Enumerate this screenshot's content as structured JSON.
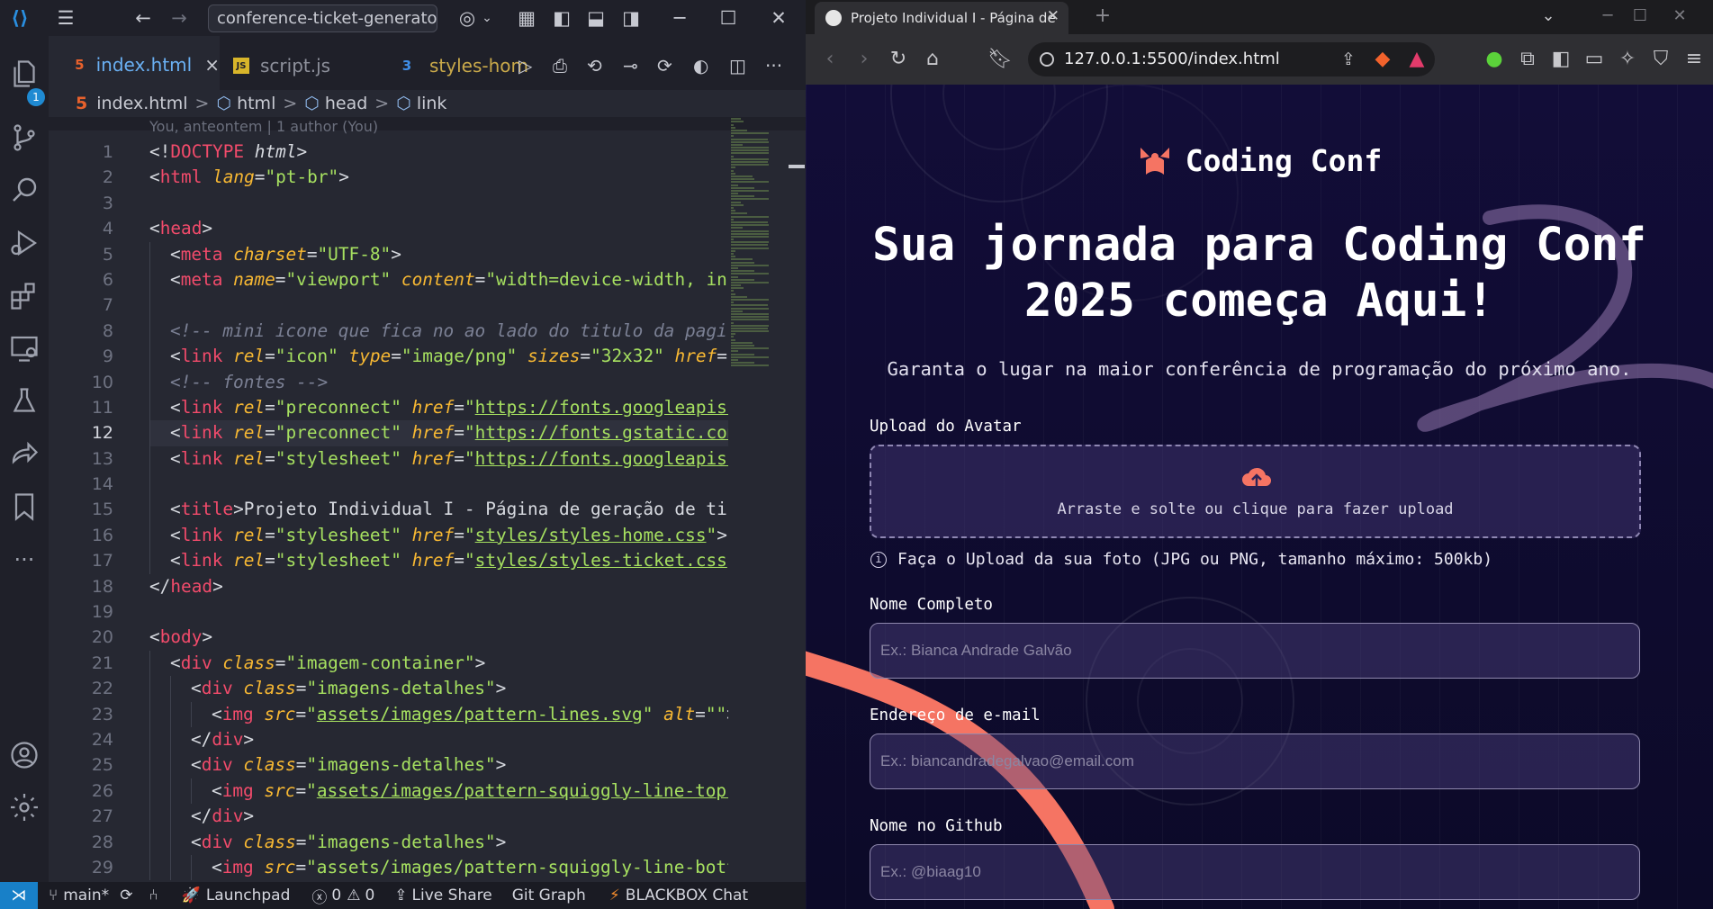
{
  "vscode": {
    "search_text": "conference-ticket-generator-m",
    "tabs": [
      {
        "label": "index.html",
        "icon": "5",
        "close": "×"
      },
      {
        "label": "script.js",
        "icon": "JS"
      },
      {
        "label": "styles-hom",
        "icon": "3"
      }
    ],
    "breadcrumb": [
      "index.html",
      "html",
      "head",
      "link"
    ],
    "breadcrumb_sep": ">",
    "blame": "You, anteontem | 1 author (You)",
    "explorer_badge": "1",
    "current_line": 12,
    "lines": [
      [
        [
          "t-punc",
          "<!"
        ],
        [
          "t-doc",
          "DOCTYPE"
        ],
        [
          "t-punc",
          " "
        ],
        [
          "t-kw",
          "html"
        ],
        [
          "t-punc",
          ">"
        ]
      ],
      [
        [
          "t-punc",
          "<"
        ],
        [
          "t-tag",
          "html"
        ],
        [
          "t-punc",
          " "
        ],
        [
          "t-attr",
          "lang"
        ],
        [
          "t-punc",
          "="
        ],
        [
          "t-str",
          "\"pt-br\""
        ],
        [
          "t-punc",
          ">"
        ]
      ],
      [],
      [
        [
          "t-punc",
          "<"
        ],
        [
          "t-tag",
          "head"
        ],
        [
          "t-punc",
          ">"
        ]
      ],
      [
        [
          "i",
          ""
        ],
        [
          "t-punc",
          "<"
        ],
        [
          "t-tag",
          "meta"
        ],
        [
          "t-punc",
          " "
        ],
        [
          "t-attr",
          "charset"
        ],
        [
          "t-punc",
          "="
        ],
        [
          "t-str",
          "\"UTF-8\""
        ],
        [
          "t-punc",
          ">"
        ]
      ],
      [
        [
          "i",
          ""
        ],
        [
          "t-punc",
          "<"
        ],
        [
          "t-tag",
          "meta"
        ],
        [
          "t-punc",
          " "
        ],
        [
          "t-attr",
          "name"
        ],
        [
          "t-punc",
          "="
        ],
        [
          "t-str",
          "\"viewport\""
        ],
        [
          "t-punc",
          " "
        ],
        [
          "t-attr",
          "content"
        ],
        [
          "t-punc",
          "="
        ],
        [
          "t-str",
          "\"width=device-width, ini"
        ]
      ],
      [
        [
          "i",
          ""
        ]
      ],
      [
        [
          "i",
          ""
        ],
        [
          "t-cmt",
          "<!-- mini icone que fica no ao lado do titulo da pagi"
        ]
      ],
      [
        [
          "i",
          ""
        ],
        [
          "t-punc",
          "<"
        ],
        [
          "t-tag",
          "link"
        ],
        [
          "t-punc",
          " "
        ],
        [
          "t-attr",
          "rel"
        ],
        [
          "t-punc",
          "="
        ],
        [
          "t-str",
          "\"icon\""
        ],
        [
          "t-punc",
          " "
        ],
        [
          "t-attr",
          "type"
        ],
        [
          "t-punc",
          "="
        ],
        [
          "t-str",
          "\"image/png\""
        ],
        [
          "t-punc",
          " "
        ],
        [
          "t-attr",
          "sizes"
        ],
        [
          "t-punc",
          "="
        ],
        [
          "t-str",
          "\"32x32\""
        ],
        [
          "t-punc",
          " "
        ],
        [
          "t-attr",
          "href"
        ],
        [
          "t-punc",
          "="
        ],
        [
          "t-str",
          "\""
        ]
      ],
      [
        [
          "i",
          ""
        ],
        [
          "t-cmt",
          "<!-- fontes -->"
        ]
      ],
      [
        [
          "i",
          ""
        ],
        [
          "t-punc",
          "<"
        ],
        [
          "t-tag",
          "link"
        ],
        [
          "t-punc",
          " "
        ],
        [
          "t-attr",
          "rel"
        ],
        [
          "t-punc",
          "="
        ],
        [
          "t-str",
          "\"preconnect\""
        ],
        [
          "t-punc",
          " "
        ],
        [
          "t-attr",
          "href"
        ],
        [
          "t-punc",
          "="
        ],
        [
          "t-str",
          "\""
        ],
        [
          "t-link",
          "https://fonts.googleapis."
        ]
      ],
      [
        [
          "i",
          ""
        ],
        [
          "t-punc",
          "<"
        ],
        [
          "t-tag",
          "link"
        ],
        [
          "t-punc",
          " "
        ],
        [
          "t-attr",
          "rel"
        ],
        [
          "t-punc",
          "="
        ],
        [
          "t-str",
          "\"preconnect\""
        ],
        [
          "t-punc",
          " "
        ],
        [
          "t-attr",
          "href"
        ],
        [
          "t-punc",
          "="
        ],
        [
          "t-str",
          "\""
        ],
        [
          "t-link",
          "https://fonts.gstatic.com"
        ]
      ],
      [
        [
          "i",
          ""
        ],
        [
          "t-punc",
          "<"
        ],
        [
          "t-tag",
          "link"
        ],
        [
          "t-punc",
          " "
        ],
        [
          "t-attr",
          "rel"
        ],
        [
          "t-punc",
          "="
        ],
        [
          "t-str",
          "\"stylesheet\""
        ],
        [
          "t-punc",
          " "
        ],
        [
          "t-attr",
          "href"
        ],
        [
          "t-punc",
          "="
        ],
        [
          "t-str",
          "\""
        ],
        [
          "t-link",
          "https://fonts.googleapis."
        ]
      ],
      [
        [
          "i",
          ""
        ]
      ],
      [
        [
          "i",
          ""
        ],
        [
          "t-punc",
          "<"
        ],
        [
          "t-tag",
          "title"
        ],
        [
          "t-punc",
          ">"
        ],
        [
          "t-punc",
          "Projeto Individual I - Página de geração de tic"
        ]
      ],
      [
        [
          "i",
          ""
        ],
        [
          "t-punc",
          "<"
        ],
        [
          "t-tag",
          "link"
        ],
        [
          "t-punc",
          " "
        ],
        [
          "t-attr",
          "rel"
        ],
        [
          "t-punc",
          "="
        ],
        [
          "t-str",
          "\"stylesheet\""
        ],
        [
          "t-punc",
          " "
        ],
        [
          "t-attr",
          "href"
        ],
        [
          "t-punc",
          "="
        ],
        [
          "t-str",
          "\""
        ],
        [
          "t-link",
          "styles/styles-home.css"
        ],
        [
          "t-str",
          "\""
        ],
        [
          "t-punc",
          ">"
        ]
      ],
      [
        [
          "i",
          ""
        ],
        [
          "t-punc",
          "<"
        ],
        [
          "t-tag",
          "link"
        ],
        [
          "t-punc",
          " "
        ],
        [
          "t-attr",
          "rel"
        ],
        [
          "t-punc",
          "="
        ],
        [
          "t-str",
          "\"stylesheet\""
        ],
        [
          "t-punc",
          " "
        ],
        [
          "t-attr",
          "href"
        ],
        [
          "t-punc",
          "="
        ],
        [
          "t-str",
          "\""
        ],
        [
          "t-link",
          "styles/styles-ticket.css"
        ],
        [
          "t-str",
          "\""
        ]
      ],
      [
        [
          "t-punc",
          "</"
        ],
        [
          "t-tag",
          "head"
        ],
        [
          "t-punc",
          ">"
        ]
      ],
      [],
      [
        [
          "t-punc",
          "<"
        ],
        [
          "t-tag",
          "body"
        ],
        [
          "t-punc",
          ">"
        ]
      ],
      [
        [
          "i",
          ""
        ],
        [
          "t-punc",
          "<"
        ],
        [
          "t-tag",
          "div"
        ],
        [
          "t-punc",
          " "
        ],
        [
          "t-attr",
          "class"
        ],
        [
          "t-punc",
          "="
        ],
        [
          "t-str",
          "\"imagem-container\""
        ],
        [
          "t-punc",
          ">"
        ]
      ],
      [
        [
          "i",
          ""
        ],
        [
          "i",
          ""
        ],
        [
          "t-punc",
          "<"
        ],
        [
          "t-tag",
          "div"
        ],
        [
          "t-punc",
          " "
        ],
        [
          "t-attr",
          "class"
        ],
        [
          "t-punc",
          "="
        ],
        [
          "t-str",
          "\"imagens-detalhes\""
        ],
        [
          "t-punc",
          ">"
        ]
      ],
      [
        [
          "i",
          ""
        ],
        [
          "i",
          ""
        ],
        [
          "i",
          ""
        ],
        [
          "t-punc",
          "<"
        ],
        [
          "t-tag",
          "img"
        ],
        [
          "t-punc",
          " "
        ],
        [
          "t-attr",
          "src"
        ],
        [
          "t-punc",
          "="
        ],
        [
          "t-str",
          "\""
        ],
        [
          "t-link",
          "assets/images/pattern-lines.svg"
        ],
        [
          "t-str",
          "\""
        ],
        [
          "t-punc",
          " "
        ],
        [
          "t-attr",
          "alt"
        ],
        [
          "t-punc",
          "="
        ],
        [
          "t-str",
          "\"\""
        ],
        [
          "t-punc",
          ">"
        ]
      ],
      [
        [
          "i",
          ""
        ],
        [
          "i",
          ""
        ],
        [
          "t-punc",
          "</"
        ],
        [
          "t-tag",
          "div"
        ],
        [
          "t-punc",
          ">"
        ]
      ],
      [
        [
          "i",
          ""
        ],
        [
          "i",
          ""
        ],
        [
          "t-punc",
          "<"
        ],
        [
          "t-tag",
          "div"
        ],
        [
          "t-punc",
          " "
        ],
        [
          "t-attr",
          "class"
        ],
        [
          "t-punc",
          "="
        ],
        [
          "t-str",
          "\"imagens-detalhes\""
        ],
        [
          "t-punc",
          ">"
        ]
      ],
      [
        [
          "i",
          ""
        ],
        [
          "i",
          ""
        ],
        [
          "i",
          ""
        ],
        [
          "t-punc",
          "<"
        ],
        [
          "t-tag",
          "img"
        ],
        [
          "t-punc",
          " "
        ],
        [
          "t-attr",
          "src"
        ],
        [
          "t-punc",
          "="
        ],
        [
          "t-str",
          "\""
        ],
        [
          "t-link",
          "assets/images/pattern-squiggly-line-top."
        ]
      ],
      [
        [
          "i",
          ""
        ],
        [
          "i",
          ""
        ],
        [
          "t-punc",
          "</"
        ],
        [
          "t-tag",
          "div"
        ],
        [
          "t-punc",
          ">"
        ]
      ],
      [
        [
          "i",
          ""
        ],
        [
          "i",
          ""
        ],
        [
          "t-punc",
          "<"
        ],
        [
          "t-tag",
          "div"
        ],
        [
          "t-punc",
          " "
        ],
        [
          "t-attr",
          "class"
        ],
        [
          "t-punc",
          "="
        ],
        [
          "t-str",
          "\"imagens-detalhes\""
        ],
        [
          "t-punc",
          ">"
        ]
      ],
      [
        [
          "i",
          ""
        ],
        [
          "i",
          ""
        ],
        [
          "i",
          ""
        ],
        [
          "t-punc",
          "<"
        ],
        [
          "t-tag",
          "img"
        ],
        [
          "t-punc",
          " "
        ],
        [
          "t-attr",
          "src"
        ],
        [
          "t-punc",
          "="
        ],
        [
          "t-str",
          "\"assets/images/pattern-squiggly-line-bott"
        ]
      ]
    ],
    "status": {
      "branch": "main*",
      "launchpad": "Launchpad",
      "errors": "0",
      "warnings": "0",
      "live_share": "Live Share",
      "git_graph": "Git Graph",
      "blackbox": "BLACKBOX Chat"
    }
  },
  "browser": {
    "tab_title": "Projeto Individual I - Página de",
    "url": "127.0.0.1:5500/index.html",
    "page": {
      "logo": "Coding Conf",
      "hero_line1": "Sua jornada para Coding Conf",
      "hero_line2": "2025 começa Aqui!",
      "subtitle": "Garanta o lugar na maior conferência de programação do próximo ano.",
      "upload_label": "Upload do Avatar",
      "upload_text": "Arraste e solte ou clique para fazer upload",
      "upload_hint_icon": "i",
      "upload_hint": "Faça o Upload da sua foto (JPG ou PNG, tamanho máximo: 500kb)",
      "name_label": "Nome Completo",
      "name_placeholder": "Ex.: Bianca Andrade Galvão",
      "email_label": "Endereço de e-mail",
      "email_placeholder": "Ex.: biancandradegalvao@email.com",
      "github_label": "Nome no Github",
      "github_placeholder": "Ex.: @biaag10"
    }
  },
  "colors": {
    "accent_coral": "#f57463",
    "vscode_accent": "#2a82d6",
    "page_bg": "#0d0a2a"
  }
}
